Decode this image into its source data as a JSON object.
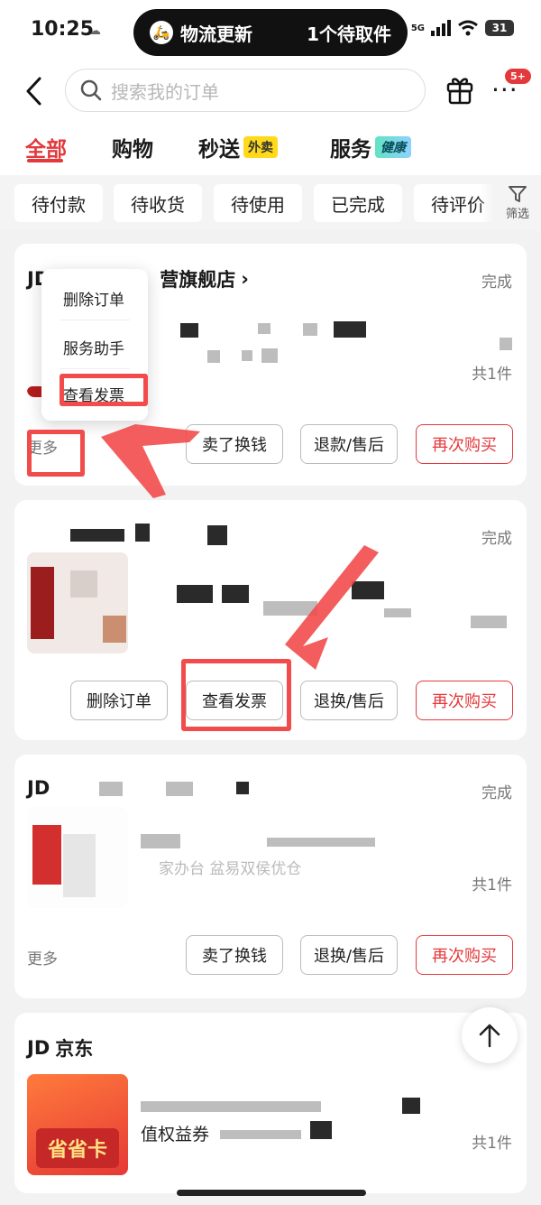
{
  "status_bar": {
    "time": "10:25",
    "island_left": "物流更新",
    "island_right": "1个待取件",
    "network": "5G",
    "battery": "31"
  },
  "header": {
    "search_placeholder": "搜索我的订单",
    "message_badge": "5+"
  },
  "tabs": [
    {
      "label": "全部",
      "active": true
    },
    {
      "label": "购物"
    },
    {
      "label": "秒送",
      "tag": "外卖"
    },
    {
      "label": "服务",
      "tag": "健康"
    }
  ],
  "filters": [
    "待付款",
    "待收货",
    "待使用",
    "已完成",
    "待评价"
  ],
  "filter_button": "筛选",
  "orders": [
    {
      "store": "营旗舰店",
      "status": "完成",
      "qty": "共1件",
      "more": "更多",
      "buttons": [
        "卖了换钱",
        "退款/售后",
        "再次购买"
      ]
    },
    {
      "status": "完成",
      "buttons": [
        "删除订单",
        "查看发票",
        "退换/售后",
        "再次购买"
      ]
    },
    {
      "status": "完成",
      "product_text": "家办台 盆易双侯优仓",
      "qty": "共1件",
      "more": "更多",
      "buttons": [
        "卖了换钱",
        "退换/售后",
        "再次购买"
      ]
    },
    {
      "store": "京东",
      "product_line2": "值权益券",
      "thumb_text": "省省卡",
      "qty": "共1件"
    }
  ],
  "popup_menu": [
    "删除订单",
    "服务助手",
    "查看发票"
  ],
  "colors": {
    "accent": "#e4393c",
    "highlight": "#f24b4b"
  }
}
